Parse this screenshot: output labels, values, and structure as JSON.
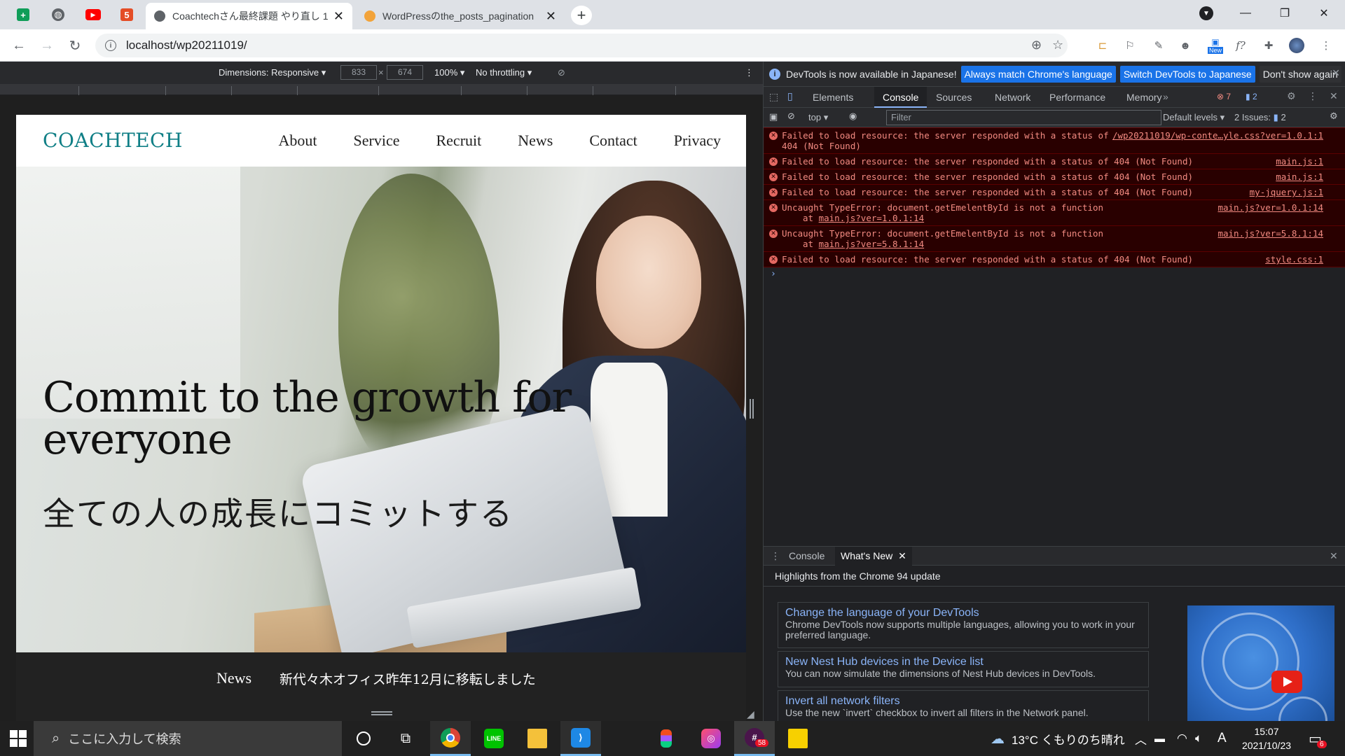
{
  "browser": {
    "tabs": [
      {
        "title": "Coachtechさん最終課題 やり直し 1",
        "active": true
      },
      {
        "title": "WordPressのthe_posts_pagination",
        "active": false
      }
    ],
    "url": "localhost/wp20211019/",
    "new_badge": "New",
    "ext_label": "f?"
  },
  "device_toolbar": {
    "dimensions_label": "Dimensions: Responsive",
    "width": "833",
    "height": "674",
    "times": "×",
    "zoom": "100%",
    "throttling": "No throttling"
  },
  "site": {
    "logo": "COACHTECH",
    "nav": [
      "About",
      "Service",
      "Recruit",
      "News",
      "Contact",
      "Privacy"
    ],
    "hero_title": "Commit to the growth for everyone",
    "hero_sub": "全ての人の成長にコミットする",
    "news_label": "News",
    "news_text": "新代々木オフィス昨年12月に移転しました"
  },
  "devtools": {
    "infobar": {
      "text": "DevTools is now available in Japanese!",
      "btn_match": "Always match Chrome's language",
      "btn_switch": "Switch DevTools to Japanese",
      "btn_dismiss": "Don't show again"
    },
    "tabs": [
      "Elements",
      "Console",
      "Sources",
      "Network",
      "Performance",
      "Memory"
    ],
    "active_tab": "Console",
    "error_count": "7",
    "message_count": "2",
    "filter": {
      "context": "top",
      "placeholder": "Filter",
      "levels": "Default levels",
      "issues": "2 Issues:",
      "issues_count": "2"
    },
    "messages": [
      {
        "text": "Failed to load resource: the server responded with a status of",
        "text2": "404 (Not Found)",
        "src": "/wp20211019/wp-conte…yle.css?ver=1.0.1:1"
      },
      {
        "text": "Failed to load resource: the server responded with a status of 404 (Not Found)",
        "src": "main.js:1"
      },
      {
        "text": "Failed to load resource: the server responded with a status of 404 (Not Found)",
        "src": "main.js:1"
      },
      {
        "text": "Failed to load resource: the server responded with a status of 404 (Not Found)",
        "src": "my-jquery.js:1"
      },
      {
        "text": "Uncaught TypeError: document.getEmelentById is not a function",
        "at": "at",
        "at_src": "main.js?ver=1.0.1:14",
        "src": "main.js?ver=1.0.1:14"
      },
      {
        "text": "Uncaught TypeError: document.getEmelentById is not a function",
        "at": "at",
        "at_src": "main.js?ver=5.8.1:14",
        "src": "main.js?ver=5.8.1:14"
      },
      {
        "text": "Failed to load resource: the server responded with a status of 404 (Not Found)",
        "src": "style.css:1"
      }
    ],
    "prompt": "›",
    "drawer": {
      "tabs": [
        "Console",
        "What's New"
      ],
      "active": "What's New",
      "heading": "Highlights from the Chrome 94 update",
      "cards": [
        {
          "title": "Change the language of your DevTools",
          "body": "Chrome DevTools now supports multiple languages, allowing you to work in your preferred language."
        },
        {
          "title": "New Nest Hub devices in the Device list",
          "body": "You can now simulate the dimensions of Nest Hub devices in DevTools."
        },
        {
          "title": "Invert all network filters",
          "body": "Use the new `invert` checkbox to invert all filters in the Network panel."
        }
      ]
    }
  },
  "taskbar": {
    "search_placeholder": "ここに入力して検索",
    "weather": "13°C くもりのち晴れ",
    "ime": "A",
    "time": "15:07",
    "date": "2021/10/23",
    "notif_count": "6",
    "app_badge": "58"
  }
}
